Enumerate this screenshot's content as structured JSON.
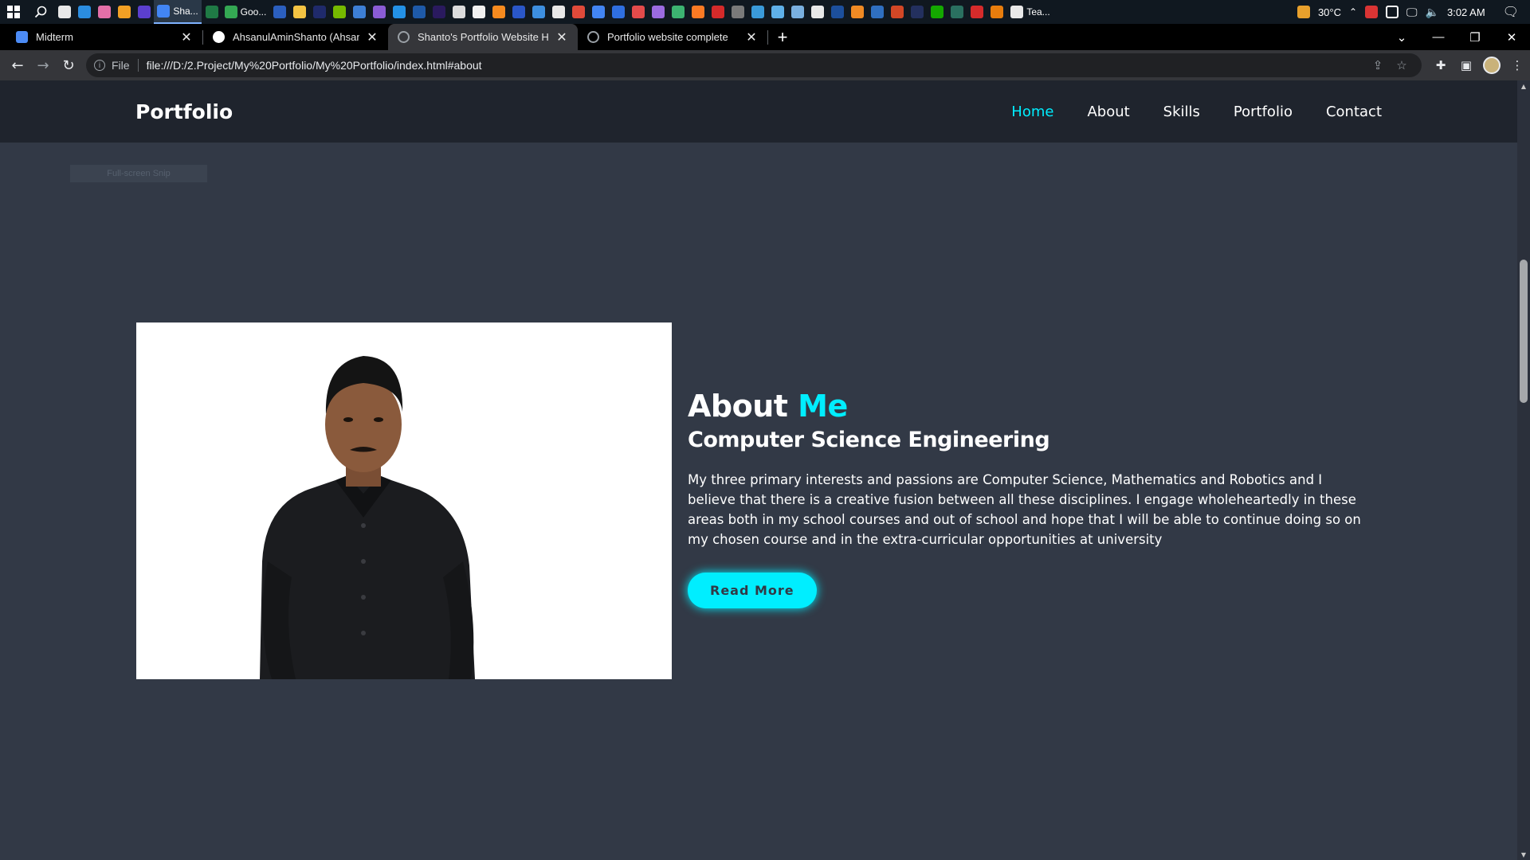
{
  "taskbar": {
    "search_icon": "search-icon",
    "apps": [
      {
        "name": "grid-app",
        "color": "#e8e8e8"
      },
      {
        "name": "edge",
        "color": "#2b8de0"
      },
      {
        "name": "pink-app",
        "color": "#e46fa8"
      },
      {
        "name": "colorful-app",
        "color": "#f2a024"
      },
      {
        "name": "obs",
        "color": "#5b3fcf"
      },
      {
        "name": "chrome-active",
        "color": "#4285f4",
        "label": "Sha..."
      },
      {
        "name": "excel",
        "color": "#1f7a45"
      },
      {
        "name": "chrome",
        "color": "#34a853",
        "label": "Goo..."
      },
      {
        "name": "word",
        "color": "#2b5fbf"
      },
      {
        "name": "explorer",
        "color": "#f3c343"
      },
      {
        "name": "animate",
        "color": "#1f2a6b"
      },
      {
        "name": "nvidia",
        "color": "#76b900"
      },
      {
        "name": "app-blue",
        "color": "#3d7fd6"
      },
      {
        "name": "visual-studio",
        "color": "#8a5cd6"
      },
      {
        "name": "vscode",
        "color": "#2391e6"
      },
      {
        "name": "app-dark",
        "color": "#1e5aa8"
      },
      {
        "name": "premiere",
        "color": "#2a1a5e"
      },
      {
        "name": "app-white",
        "color": "#dcdcdc"
      },
      {
        "name": "github",
        "color": "#f0f0f0"
      },
      {
        "name": "sublime",
        "color": "#f58a1f"
      },
      {
        "name": "app-navy",
        "color": "#2a57c8"
      },
      {
        "name": "mail",
        "color": "#3d8fe0"
      },
      {
        "name": "pycharm",
        "color": "#e8e8e8"
      },
      {
        "name": "app-rainbow",
        "color": "#e04a3a"
      },
      {
        "name": "chrome-2",
        "color": "#4285f4"
      },
      {
        "name": "app-blue-2",
        "color": "#2f6fe0"
      },
      {
        "name": "vivaldi",
        "color": "#e34b4b"
      },
      {
        "name": "github-desktop",
        "color": "#9b6be0"
      },
      {
        "name": "app-green",
        "color": "#3cb371"
      },
      {
        "name": "xampp",
        "color": "#fb7a24"
      },
      {
        "name": "acrobat",
        "color": "#d42a2a"
      },
      {
        "name": "app-gray",
        "color": "#7a7a7a"
      },
      {
        "name": "snip",
        "color": "#3a9ad9"
      },
      {
        "name": "notepad",
        "color": "#5fb0e8"
      },
      {
        "name": "keyboard",
        "color": "#7ab0e0"
      },
      {
        "name": "app-bird",
        "color": "#e8e8e8"
      },
      {
        "name": "photoshop",
        "color": "#1c4f9c"
      },
      {
        "name": "blender-orange",
        "color": "#f08a24"
      },
      {
        "name": "virtualbox",
        "color": "#2f6fc0"
      },
      {
        "name": "powerpoint",
        "color": "#d24726"
      },
      {
        "name": "app-navy-2",
        "color": "#23305e"
      },
      {
        "name": "upwork",
        "color": "#14a800"
      },
      {
        "name": "app-teal",
        "color": "#2a7060"
      },
      {
        "name": "app-red",
        "color": "#d62b2b"
      },
      {
        "name": "blender",
        "color": "#e87d0d"
      },
      {
        "name": "teams",
        "color": "#e8e8e8",
        "label": "Tea..."
      }
    ],
    "weather": "30°C",
    "time": "3:02 AM"
  },
  "browser": {
    "tabs": [
      {
        "label": "Midterm",
        "favicon_color": "#4c8bf5",
        "active": false
      },
      {
        "label": "AhsanulAminShanto (Ahsanul Am",
        "favicon_color": "#ffffff",
        "active": false
      },
      {
        "label": "Shanto's Portfolio Website HTML",
        "favicon_color": "#9aa0a6",
        "active": true
      },
      {
        "label": "Portfolio website complete",
        "favicon_color": "#9aa0a6",
        "active": false
      }
    ],
    "new_tab": "+",
    "window_controls": [
      "⌄",
      "—",
      "❐",
      "✕"
    ],
    "address": {
      "chip": "File",
      "url": "file:///D:/2.Project/My%20Portfolio/My%20Portfolio/index.html#about"
    }
  },
  "site": {
    "logo": "Portfolio",
    "nav": [
      {
        "label": "Home",
        "active": true
      },
      {
        "label": "About",
        "active": false
      },
      {
        "label": "Skills",
        "active": false
      },
      {
        "label": "Portfolio",
        "active": false
      },
      {
        "label": "Contact",
        "active": false
      }
    ],
    "snip_hint": "Full-screen Snip",
    "about": {
      "title_main": "About",
      "title_accent": "Me",
      "subtitle": "Computer Science Engineering",
      "text": "My three primary interests and passions are Computer Science, Mathematics and Robotics and I believe that there is a creative fusion between all these disciplines. I engage wholeheartedly in these areas both in my school courses and out of school and hope that I will be able to continue doing so on my chosen course and in the extra-curricular opportunities at university",
      "button": "Read More"
    },
    "colors": {
      "accent": "#00eeff",
      "background": "#323946",
      "header": "#1f242d",
      "text": "#ffffff"
    }
  }
}
